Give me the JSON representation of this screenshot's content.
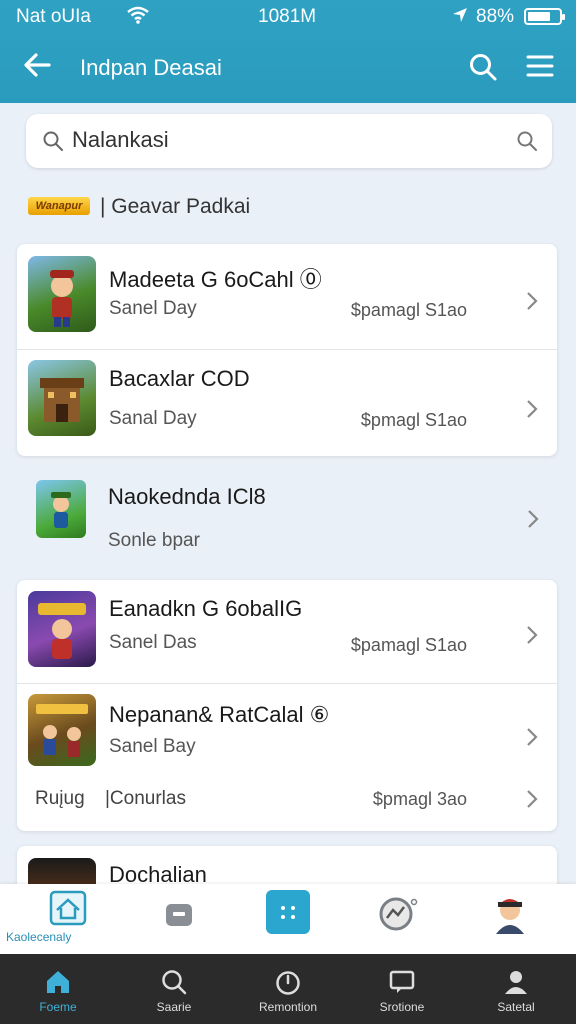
{
  "status_bar": {
    "carrier": "Nat oUIa",
    "time": "1081M",
    "battery": "88%"
  },
  "app_bar": {
    "title": "Indpan Deasai"
  },
  "search": {
    "value": "Nalankasi"
  },
  "section": {
    "badge": "Wanapur",
    "label": "| Geavar Padkai"
  },
  "cards": [
    {
      "rows": [
        {
          "name": "Madeeta G 6oCahl ⓪",
          "sub": "Sanel Day",
          "price": "$pamagl S1ao",
          "thumb_color": "#4a7a2a"
        },
        {
          "name": "Bacaxlar COD",
          "sub": "Sanal Day",
          "price": "$pmagl S1ao",
          "thumb_color": "#6a8a2c"
        }
      ]
    },
    {
      "plain": {
        "name": "Naokednda ICl8",
        "sub": "Sonle bpar",
        "thumb_color": "#3c8dbf"
      }
    },
    {
      "rows": [
        {
          "name": "Eanadkn G 6obalIG",
          "sub": "Sanel Das",
          "price": "$pamagl S1ao",
          "thumb_color": "#5a3a8a"
        },
        {
          "name": "Nepanan& RatCalal ⑥",
          "sub": "Sanel Bay",
          "price": "",
          "thumb_color": "#7a5a2a"
        }
      ],
      "footer": {
        "left": "Ruįug",
        "mid": "|Conurlas",
        "price": "$pmagl 3ao"
      }
    },
    {
      "rows": [
        {
          "name": "Dochalian",
          "thumb_color": "#3a2a1a"
        }
      ]
    }
  ],
  "tabs_top": [
    {
      "label": "Kaolecenaly",
      "icon": "home-check-icon"
    },
    {
      "label": "",
      "icon": "wallet-icon"
    },
    {
      "label": "",
      "icon": "grid-icon"
    },
    {
      "label": "",
      "icon": "chart-icon"
    },
    {
      "label": "",
      "icon": "avatar-icon"
    }
  ],
  "nav": [
    {
      "label": "Foeme",
      "icon": "home-icon",
      "active": true
    },
    {
      "label": "Saarie",
      "icon": "search-icon"
    },
    {
      "label": "Remontion",
      "icon": "timer-icon"
    },
    {
      "label": "Srotione",
      "icon": "chat-icon"
    },
    {
      "label": "Satetal",
      "icon": "person-icon"
    }
  ],
  "colors": {
    "accent": "#2a9bbd",
    "nav_bg": "#2b2b2b",
    "page_bg": "#eaf0f7"
  }
}
